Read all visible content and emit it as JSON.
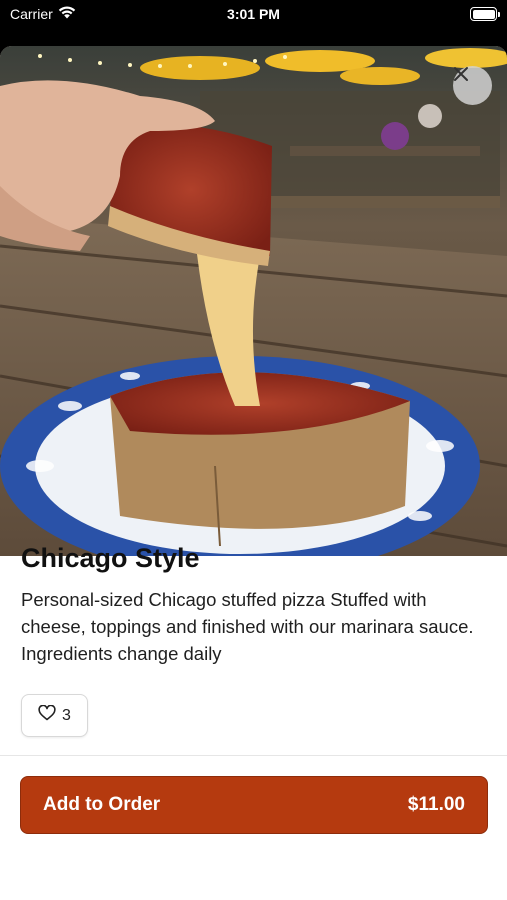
{
  "status_bar": {
    "carrier": "Carrier",
    "time": "3:01 PM"
  },
  "item": {
    "title": "Chicago Style",
    "description": "Personal-sized Chicago stuffed pizza Stuffed with cheese, toppings and finished with our marinara sauce. Ingredients change daily",
    "likes": "3"
  },
  "order": {
    "label": "Add to Order",
    "price": "$11.00"
  },
  "icons": {
    "close": "close-icon",
    "like": "heart-icon",
    "wifi": "wifi-icon",
    "battery": "battery-icon"
  },
  "colors": {
    "accent": "#b53a0f"
  }
}
